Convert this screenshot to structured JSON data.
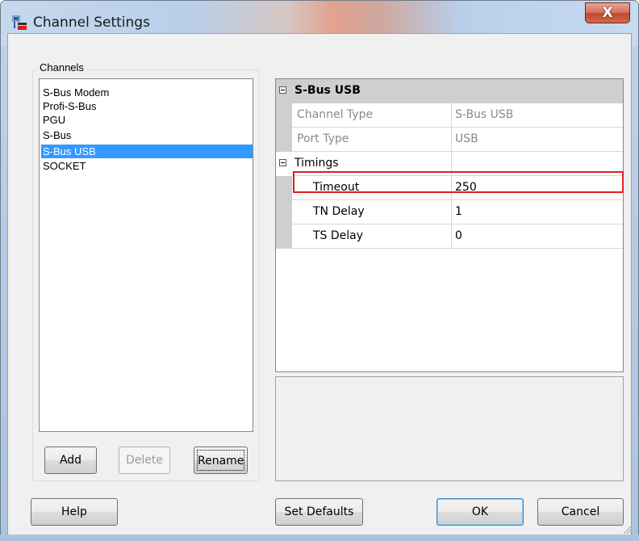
{
  "window": {
    "title": "Channel Settings",
    "close_glyph": "X",
    "icon": "channel-settings-app-icon"
  },
  "channels": {
    "group_label": "Channels",
    "items": [
      {
        "label": "S-Bus Modem",
        "selected": false
      },
      {
        "label": "Profi-S-Bus",
        "selected": false
      },
      {
        "label": "PGU",
        "selected": false
      },
      {
        "label": "S-Bus",
        "selected": false
      },
      {
        "label": "S-Bus USB",
        "selected": true
      },
      {
        "label": "SOCKET",
        "selected": false
      }
    ],
    "add_label": "Add",
    "delete_label": "Delete",
    "rename_label": "Rename"
  },
  "properties": {
    "category_sbus_usb": "S-Bus USB",
    "channel_type_name": "Channel Type",
    "channel_type_value": "S-Bus USB",
    "port_type_name": "Port Type",
    "port_type_value": "USB",
    "category_timings": "Timings",
    "timeout_name": "Timeout",
    "timeout_value": "250",
    "tn_delay_name": "TN Delay",
    "tn_delay_value": "1",
    "ts_delay_name": "TS Delay",
    "ts_delay_value": "0"
  },
  "footer": {
    "help_label": "Help",
    "set_defaults_label": "Set Defaults",
    "ok_label": "OK",
    "cancel_label": "Cancel"
  },
  "colors": {
    "selection": "#3399ff",
    "highlight_border": "#e02020",
    "close_button": "#c2472f"
  }
}
